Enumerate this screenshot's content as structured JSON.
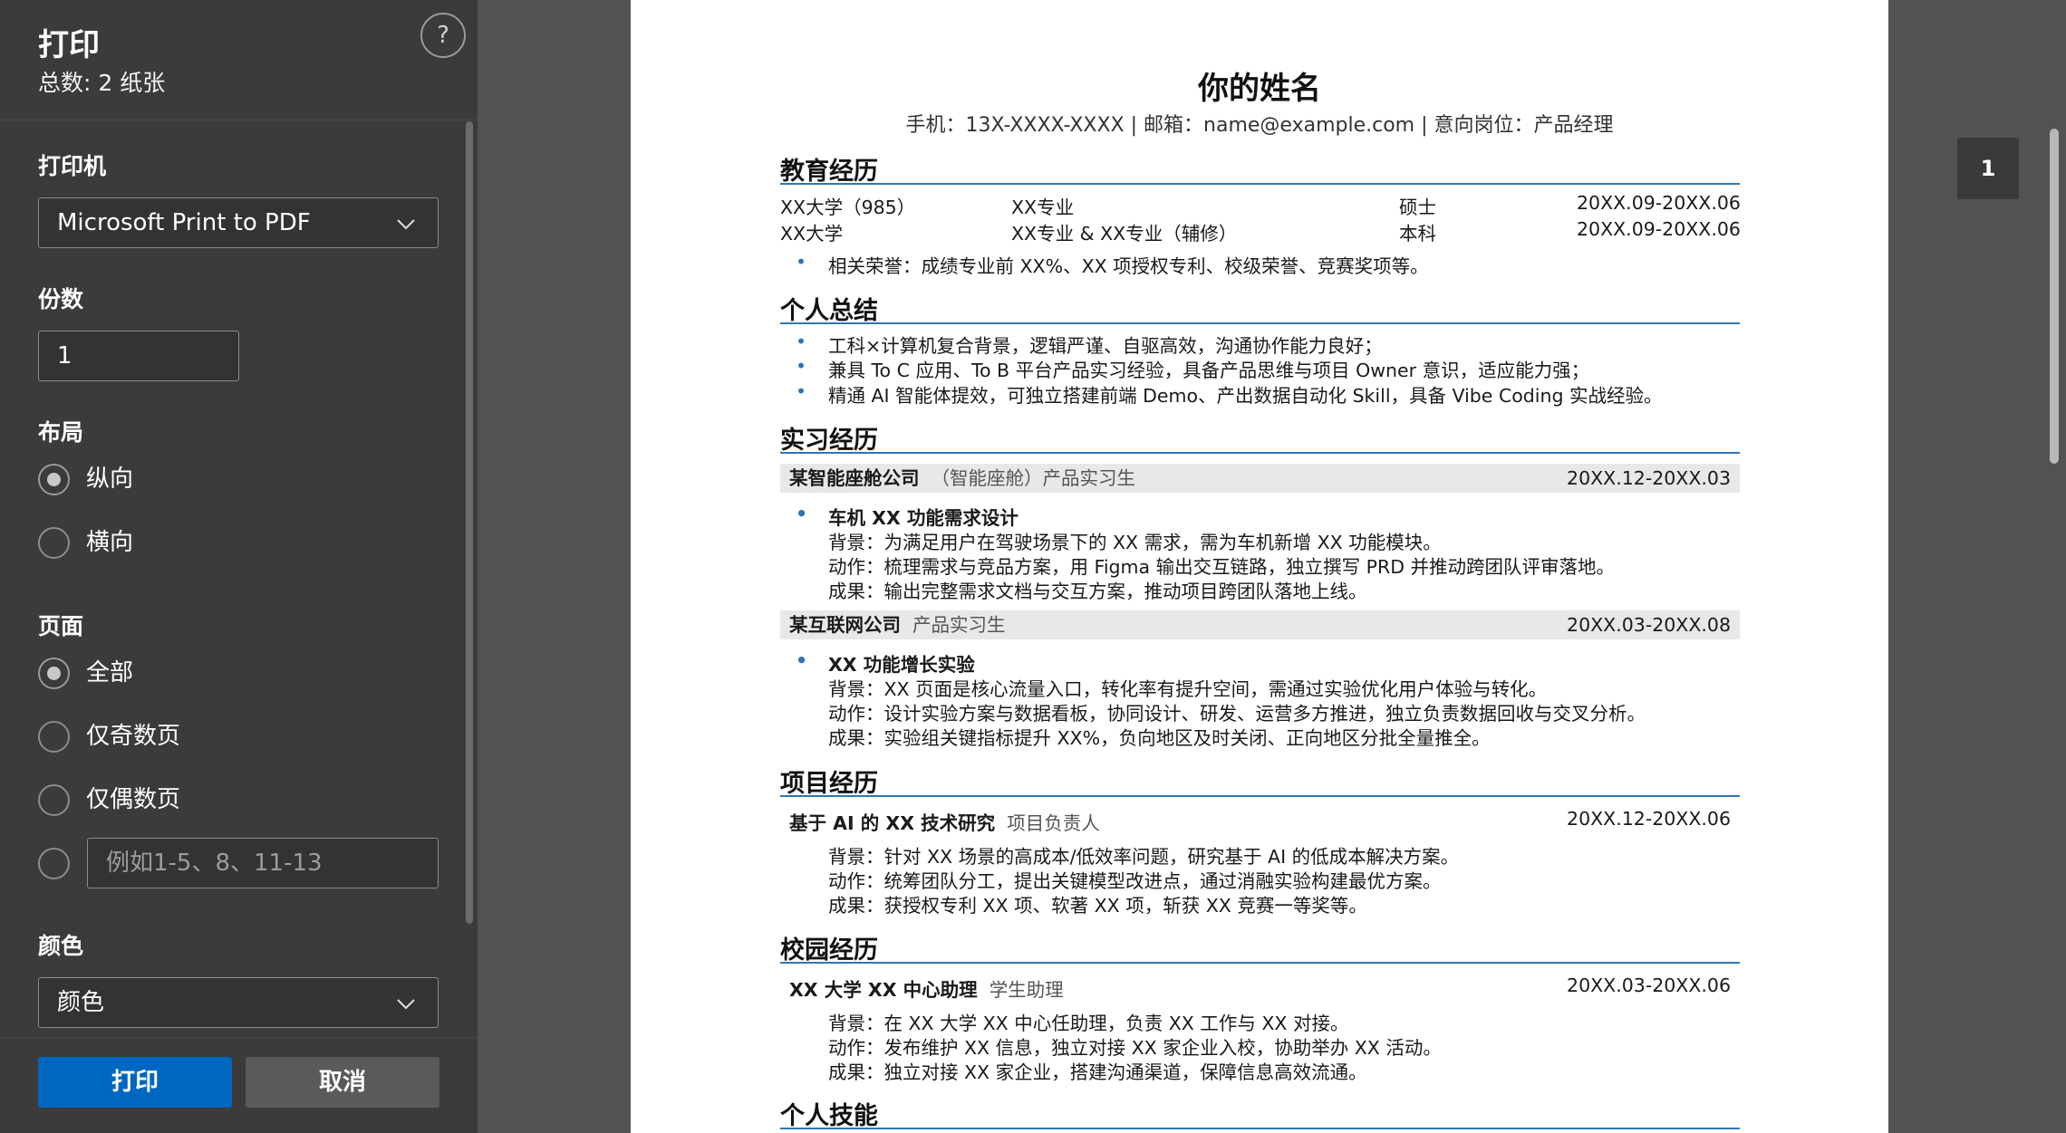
{
  "panel": {
    "title": "打印",
    "subtitle": "总数: 2 纸张",
    "help": "?",
    "printer": {
      "label": "打印机",
      "value": "Microsoft Print to PDF"
    },
    "copies": {
      "label": "份数",
      "value": "1"
    },
    "layout": {
      "label": "布局",
      "options": [
        "纵向",
        "横向"
      ],
      "selected": "纵向"
    },
    "pages": {
      "label": "页面",
      "options": [
        "全部",
        "仅奇数页",
        "仅偶数页"
      ],
      "selected": "全部",
      "custom_placeholder": "例如1-5、8、11-13"
    },
    "color": {
      "label": "颜色",
      "value": "颜色"
    },
    "print_button": "打印",
    "cancel_button": "取消"
  },
  "preview": {
    "page_number": "1",
    "name": "你的姓名",
    "contact": "手机：13X-XXXX-XXXX | 邮箱：name@example.com | 意向岗位：产品经理",
    "education": {
      "title": "教育经历",
      "rows": [
        {
          "school": "XX大学（985）",
          "major": "XX专业",
          "degree": "硕士",
          "date": "20XX.09-20XX.06"
        },
        {
          "school": "XX大学",
          "major": "XX专业 & XX专业（辅修）",
          "degree": "本科",
          "date": "20XX.09-20XX.06"
        }
      ],
      "honor": "相关荣誉：成绩专业前 XX%、XX 项授权专利、校级荣誉、竞赛奖项等。"
    },
    "summary": {
      "title": "个人总结",
      "items": [
        "工科×计算机复合背景，逻辑严谨、自驱高效，沟通协作能力良好；",
        "兼具 To C 应用、To B 平台产品实习经验，具备产品思维与项目 Owner 意识，适应能力强；",
        "精通 AI 智能体提效，可独立搭建前端 Demo、产出数据自动化 Skill，具备 Vibe Coding 实战经验。"
      ]
    },
    "internship": {
      "title": "实习经历",
      "jobs": [
        {
          "company": "某智能座舱公司",
          "role": "（智能座舱）产品实习生",
          "date": "20XX.12-20XX.03",
          "project": "车机 XX 功能需求设计",
          "lines": [
            "背景：为满足用户在驾驶场景下的 XX 需求，需为车机新增 XX 功能模块。",
            "动作：梳理需求与竞品方案，用 Figma 输出交互链路，独立撰写 PRD 并推动跨团队评审落地。",
            "成果：输出完整需求文档与交互方案，推动项目跨团队落地上线。"
          ]
        },
        {
          "company": "某互联网公司",
          "role": "产品实习生",
          "date": "20XX.03-20XX.08",
          "project": "XX 功能增长实验",
          "lines": [
            "背景：XX 页面是核心流量入口，转化率有提升空间，需通过实验优化用户体验与转化。",
            "动作：设计实验方案与数据看板，协同设计、研发、运营多方推进，独立负责数据回收与交叉分析。",
            "成果：实验组关键指标提升 XX%，负向地区及时关闭、正向地区分批全量推全。"
          ]
        }
      ]
    },
    "projects": {
      "title": "项目经历",
      "name": "基于 AI 的 XX 技术研究",
      "role": "项目负责人",
      "date": "20XX.12-20XX.06",
      "lines": [
        "背景：针对 XX 场景的高成本/低效率问题，研究基于 AI 的低成本解决方案。",
        "动作：统筹团队分工，提出关键模型改进点，通过消融实验构建最优方案。",
        "成果：获授权专利 XX 项、软著 XX 项，斩获 XX 竞赛一等奖等。"
      ]
    },
    "campus": {
      "title": "校园经历",
      "name": "XX 大学 XX 中心助理",
      "role": "学生助理",
      "date": "20XX.03-20XX.06",
      "lines": [
        "背景：在 XX 大学 XX 中心任助理，负责 XX 工作与 XX 对接。",
        "动作：发布维护 XX 信息，独立对接 XX 家企业入校，协助举办 XX 活动。",
        "成果：独立对接 XX 家企业，搭建沟通渠道，保障信息高效流通。"
      ]
    },
    "skills": {
      "title": "个人技能"
    }
  }
}
